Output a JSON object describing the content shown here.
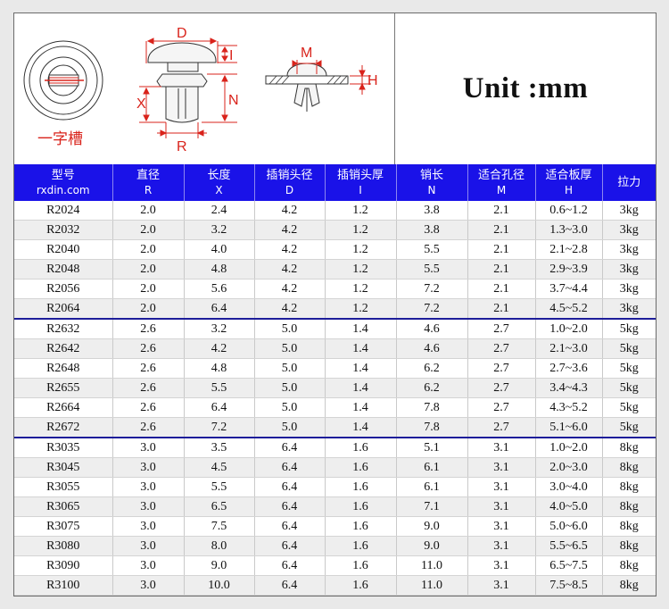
{
  "drawing": {
    "slot_caption": "一字槽",
    "dim_labels": {
      "D": "D",
      "I": "I",
      "N": "N",
      "X": "X",
      "R": "R",
      "M": "M",
      "H": "H"
    }
  },
  "unit_label": "Unit :mm",
  "colors": {
    "header_bg": "#1a12e8",
    "dimension_red": "#d9231b",
    "group_divider": "#1d1d9a"
  },
  "headers": [
    {
      "label": "型号",
      "sub": "rxdin.com"
    },
    {
      "label": "直径",
      "sub": "R"
    },
    {
      "label": "长度",
      "sub": "X"
    },
    {
      "label": "插销头径",
      "sub": "D"
    },
    {
      "label": "插销头厚",
      "sub": "I"
    },
    {
      "label": "销长",
      "sub": "N"
    },
    {
      "label": "适合孔径",
      "sub": "M"
    },
    {
      "label": "适合板厚",
      "sub": "H"
    },
    {
      "label": "拉力",
      "sub": ""
    }
  ],
  "rows": [
    [
      "R2024",
      "2.0",
      "2.4",
      "4.2",
      "1.2",
      "3.8",
      "2.1",
      "0.6~1.2",
      "3kg"
    ],
    [
      "R2032",
      "2.0",
      "3.2",
      "4.2",
      "1.2",
      "3.8",
      "2.1",
      "1.3~3.0",
      "3kg"
    ],
    [
      "R2040",
      "2.0",
      "4.0",
      "4.2",
      "1.2",
      "5.5",
      "2.1",
      "2.1~2.8",
      "3kg"
    ],
    [
      "R2048",
      "2.0",
      "4.8",
      "4.2",
      "1.2",
      "5.5",
      "2.1",
      "2.9~3.9",
      "3kg"
    ],
    [
      "R2056",
      "2.0",
      "5.6",
      "4.2",
      "1.2",
      "7.2",
      "2.1",
      "3.7~4.4",
      "3kg"
    ],
    [
      "R2064",
      "2.0",
      "6.4",
      "4.2",
      "1.2",
      "7.2",
      "2.1",
      "4.5~5.2",
      "3kg"
    ],
    [
      "R2632",
      "2.6",
      "3.2",
      "5.0",
      "1.4",
      "4.6",
      "2.7",
      "1.0~2.0",
      "5kg"
    ],
    [
      "R2642",
      "2.6",
      "4.2",
      "5.0",
      "1.4",
      "4.6",
      "2.7",
      "2.1~3.0",
      "5kg"
    ],
    [
      "R2648",
      "2.6",
      "4.8",
      "5.0",
      "1.4",
      "6.2",
      "2.7",
      "2.7~3.6",
      "5kg"
    ],
    [
      "R2655",
      "2.6",
      "5.5",
      "5.0",
      "1.4",
      "6.2",
      "2.7",
      "3.4~4.3",
      "5kg"
    ],
    [
      "R2664",
      "2.6",
      "6.4",
      "5.0",
      "1.4",
      "7.8",
      "2.7",
      "4.3~5.2",
      "5kg"
    ],
    [
      "R2672",
      "2.6",
      "7.2",
      "5.0",
      "1.4",
      "7.8",
      "2.7",
      "5.1~6.0",
      "5kg"
    ],
    [
      "R3035",
      "3.0",
      "3.5",
      "6.4",
      "1.6",
      "5.1",
      "3.1",
      "1.0~2.0",
      "8kg"
    ],
    [
      "R3045",
      "3.0",
      "4.5",
      "6.4",
      "1.6",
      "6.1",
      "3.1",
      "2.0~3.0",
      "8kg"
    ],
    [
      "R3055",
      "3.0",
      "5.5",
      "6.4",
      "1.6",
      "6.1",
      "3.1",
      "3.0~4.0",
      "8kg"
    ],
    [
      "R3065",
      "3.0",
      "6.5",
      "6.4",
      "1.6",
      "7.1",
      "3.1",
      "4.0~5.0",
      "8kg"
    ],
    [
      "R3075",
      "3.0",
      "7.5",
      "6.4",
      "1.6",
      "9.0",
      "3.1",
      "5.0~6.0",
      "8kg"
    ],
    [
      "R3080",
      "3.0",
      "8.0",
      "6.4",
      "1.6",
      "9.0",
      "3.1",
      "5.5~6.5",
      "8kg"
    ],
    [
      "R3090",
      "3.0",
      "9.0",
      "6.4",
      "1.6",
      "11.0",
      "3.1",
      "6.5~7.5",
      "8kg"
    ],
    [
      "R3100",
      "3.0",
      "10.0",
      "6.4",
      "1.6",
      "11.0",
      "3.1",
      "7.5~8.5",
      "8kg"
    ]
  ],
  "group_start_rows": [
    6,
    12
  ]
}
